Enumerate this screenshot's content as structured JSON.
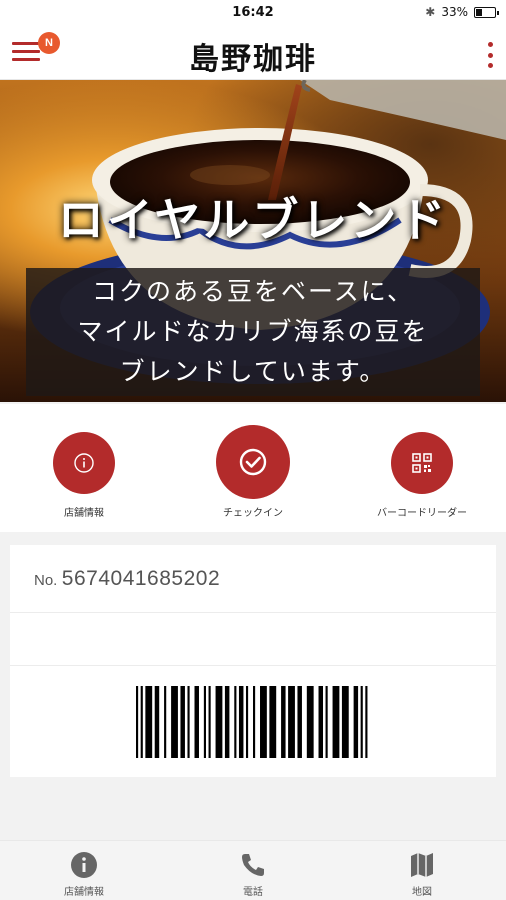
{
  "status_bar": {
    "time": "16:42",
    "battery_text": "33%",
    "battery_level": 0.33,
    "bluetooth_icon": "bluetooth-icon"
  },
  "header": {
    "logo_text": "島野珈琲",
    "notification_badge": "N",
    "menu_icon": "hamburger-menu-icon",
    "more_icon": "more-vertical-icon",
    "accent_color": "#b32b2b",
    "badge_color": "#e8592e"
  },
  "hero": {
    "title": "ロイヤルブレンド",
    "caption_lines": [
      "コクのある豆をベースに、",
      "マイルドなカリブ海系の豆を",
      "ブレンドしています。"
    ]
  },
  "actions": [
    {
      "label": "店舗情報",
      "icon": "info-icon"
    },
    {
      "label": "チェックイン",
      "icon": "checkmark-icon"
    },
    {
      "label": "バーコードリーダー",
      "icon": "qr-code-icon"
    }
  ],
  "member_card": {
    "number_prefix": "No.",
    "number": "5674041685202"
  },
  "bottom_nav": [
    {
      "label": "店舗情報",
      "icon": "info-icon"
    },
    {
      "label": "電話",
      "icon": "phone-icon"
    },
    {
      "label": "地図",
      "icon": "map-icon"
    }
  ]
}
